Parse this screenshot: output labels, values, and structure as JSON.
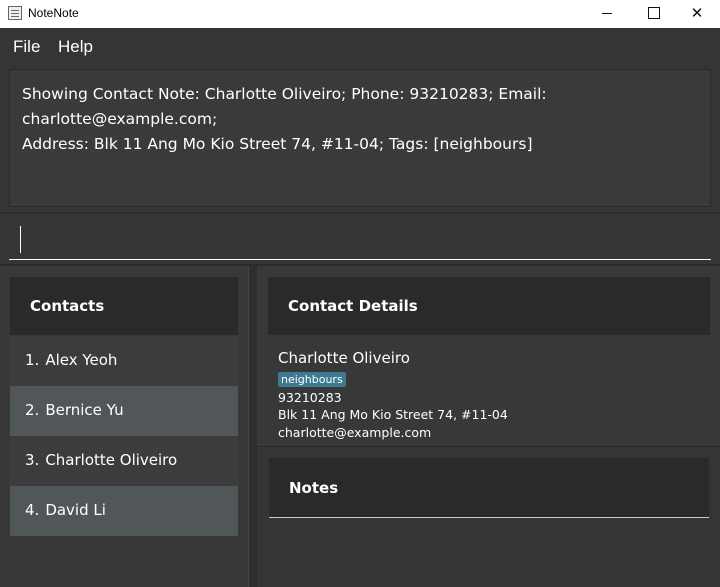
{
  "window": {
    "title": "NoteNote",
    "app_icon": "notepad-icon",
    "controls": {
      "minimize": "minimize-icon",
      "maximize": "maximize-icon",
      "close": "✕"
    }
  },
  "menu": {
    "file": "File",
    "help": "Help"
  },
  "result_display": {
    "line1": "Showing Contact Note: Charlotte Oliveiro; Phone: 93210283; Email: charlotte@example.com;",
    "line2": "Address: Blk 11 Ang Mo Kio Street 74, #11-04; Tags: [neighbours]"
  },
  "command_box": {
    "value": ""
  },
  "contacts": {
    "title": "Contacts",
    "items": [
      {
        "index": "1.",
        "name": "Alex Yeoh"
      },
      {
        "index": "2.",
        "name": "Bernice Yu"
      },
      {
        "index": "3.",
        "name": "Charlotte Oliveiro"
      },
      {
        "index": "4.",
        "name": "David Li"
      }
    ]
  },
  "details": {
    "title": "Contact Details",
    "name": "Charlotte Oliveiro",
    "tag": "neighbours",
    "phone": "93210283",
    "address": "Blk 11 Ang Mo Kio Street 74, #11-04",
    "email": "charlotte@example.com"
  },
  "notes": {
    "title": "Notes"
  },
  "colors": {
    "background": "#353535",
    "header": "#2a2a2a",
    "row_dark": "#3c3c3c",
    "row_light": "#515658",
    "tag": "#3e7b91"
  }
}
